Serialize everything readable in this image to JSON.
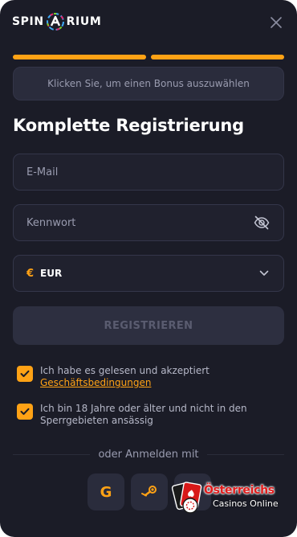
{
  "header": {
    "logo_left": "SPIN",
    "logo_right": "RIUM",
    "close_icon": "close-icon"
  },
  "progress": {
    "steps_total": 2,
    "steps_completed": 2,
    "color": "#ffa215"
  },
  "bonus": {
    "label": "Klicken Sie, um einen Bonus auszuwählen"
  },
  "form": {
    "title": "Komplette Registrierung",
    "email_placeholder": "E-Mail",
    "password_placeholder": "Kennwort",
    "password_toggle_icon": "eye-off-icon",
    "currency_symbol": "€",
    "currency_code": "EUR",
    "currency_chevron_icon": "chevron-down-icon",
    "register_label": "REGISTRIEREN"
  },
  "consents": {
    "terms_text": "Ich habe es gelesen und akzeptiert",
    "terms_link": "Geschäftsbedingungen",
    "terms_checked": true,
    "age_text": "Ich bin 18 Jahre oder älter und nicht in den Sperrgebieten ansässig",
    "age_checked": true
  },
  "social": {
    "divider_label": "oder Anmelden mit",
    "providers": [
      {
        "name": "Google",
        "icon": "google-icon",
        "glyph": "G"
      },
      {
        "name": "Steam",
        "icon": "steam-icon"
      },
      {
        "name": "Other",
        "icon": "social-icon"
      }
    ]
  },
  "watermark": {
    "title": "Österreichs",
    "subtitle": "Casinos Online"
  },
  "colors": {
    "background": "#1b1c27",
    "accent": "#ffa215",
    "field": "#20212e",
    "text_muted": "#9a9cb0"
  }
}
